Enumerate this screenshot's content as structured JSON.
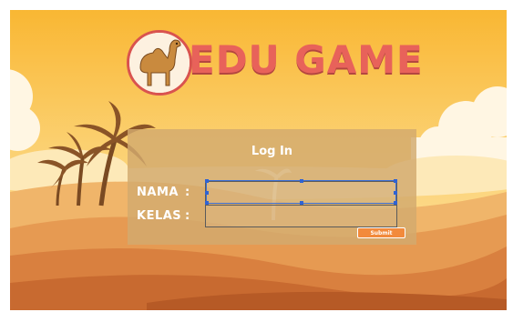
{
  "game": {
    "logo_text": "EDU GAME"
  },
  "login": {
    "title": "Log In",
    "nama_label": "NAMA",
    "kelas_label": "KELAS",
    "separator": ":",
    "nama_value": "",
    "kelas_value": "",
    "submit_label": "Submit"
  },
  "colors": {
    "sky_top": "#f9bb3a",
    "sand": "#e9a15a",
    "logo_red": "#e8625a",
    "panel": "#d2aa6e",
    "submit_orange": "#f28a3c",
    "selection_blue": "#2f63d3"
  }
}
